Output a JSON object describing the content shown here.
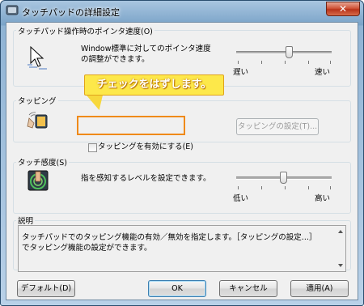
{
  "window": {
    "title": "タッチパッドの詳細設定",
    "close_label": "✕"
  },
  "speed_group": {
    "label": "タッチパッド操作時のポインタ速度(O)",
    "description": "Window標準に対してのポインタ速度\nの調整ができます。",
    "slider_min": "遅い",
    "slider_max": "速い",
    "slider_value_fraction": 0.6
  },
  "tapping_group": {
    "label": "タッピング",
    "checkbox_label": "タッピングを有効にする(E)",
    "checkbox_checked": false,
    "settings_button": "タッピングの設定(T)..."
  },
  "sensitivity_group": {
    "label": "タッチ感度(S)",
    "description": "指を感知するレベルを設定できます。",
    "slider_min": "低い",
    "slider_max": "高い",
    "slider_value_fraction": 0.5
  },
  "description_group": {
    "label": "説明",
    "text": "タッチパッドでのタッピング機能の有効／無効を指定します。［タッピングの設定...］でタッピング機能の設定ができます。"
  },
  "annotation": {
    "callout_text": "チェックをはずします。",
    "callout_color": "#fde84a",
    "highlight_color": "#ef8a19"
  },
  "buttons": {
    "default_label": "デフォルト(D)",
    "ok_label": "OK",
    "cancel_label": "キャンセル",
    "apply_label": "適用(A)"
  },
  "colors": {
    "titlebar": "#7aa3c8",
    "client_bg": "#f0f0f0",
    "close_button": "#d0553a"
  }
}
